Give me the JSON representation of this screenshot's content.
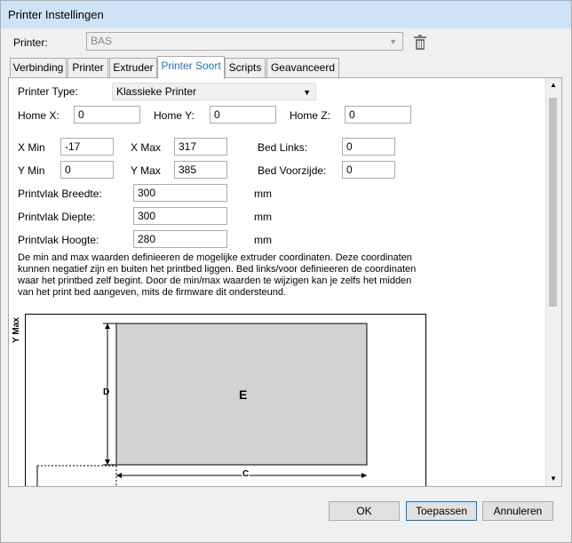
{
  "window": {
    "title": "Printer Instellingen"
  },
  "printer": {
    "label": "Printer:",
    "value": "BAS"
  },
  "tabs": [
    {
      "label": "Verbinding"
    },
    {
      "label": "Printer"
    },
    {
      "label": "Extruder"
    },
    {
      "label": "Printer Soort"
    },
    {
      "label": "Scripts"
    },
    {
      "label": "Geavanceerd"
    }
  ],
  "form": {
    "printer_type_label": "Printer Type:",
    "printer_type_value": "Klassieke Printer",
    "home_x_label": "Home X:",
    "home_x": "0",
    "home_y_label": "Home Y:",
    "home_y": "0",
    "home_z_label": "Home Z:",
    "home_z": "0",
    "x_min_label": "X Min",
    "x_min": "-17",
    "x_max_label": "X Max",
    "x_max": "317",
    "bed_links_label": "Bed Links:",
    "bed_links": "0",
    "y_min_label": "Y Min",
    "y_min": "0",
    "y_max_label": "Y Max",
    "y_max": "385",
    "bed_voorzijde_label": "Bed Voorzijde:",
    "bed_voorzijde": "0",
    "breedte_label": "Printvlak Breedte:",
    "breedte": "300",
    "diepte_label": "Printvlak Diepte:",
    "diepte": "300",
    "hoogte_label": "Printvlak Hoogte:",
    "hoogte": "280",
    "unit": "mm",
    "description_lines": [
      "De min and max waarden definieeren de mogelijke extruder coordinaten. Deze coordinaten",
      "kunnen negatief zijn en buiten het printbed liggen. Bed links/voor definieeren de coordinaten",
      "waar het printbed zelf begint. Door de min/max waarden te wijzigen kan je zelfs het midden",
      "van het print bed aangeven, mits de firmware dit ondersteund."
    ]
  },
  "diagram": {
    "ymax_label": "Y Max",
    "d_label": "D",
    "e_label": "E",
    "c_label": "C"
  },
  "buttons": {
    "ok": "OK",
    "apply": "Toepassen",
    "cancel": "Annuleren"
  }
}
